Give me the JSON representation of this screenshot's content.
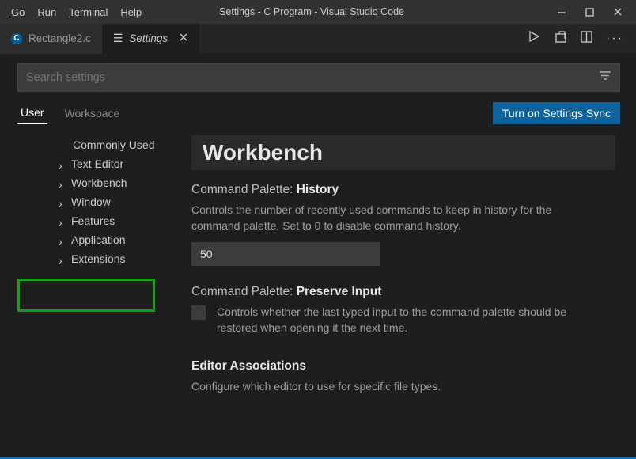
{
  "titlebar": {
    "menus": [
      "Go",
      "Run",
      "Terminal",
      "Help"
    ],
    "title": "Settings - C Program - Visual Studio Code"
  },
  "tabs": [
    {
      "label": "Rectangle2.c",
      "icon": "c-lang",
      "active": false
    },
    {
      "label": "Settings",
      "icon": "gear",
      "active": true
    }
  ],
  "search": {
    "placeholder": "Search settings"
  },
  "scope": {
    "user": "User",
    "workspace": "Workspace"
  },
  "syncButton": "Turn on Settings Sync",
  "sidebar": {
    "items": [
      {
        "label": "Commonly Used",
        "expandable": false
      },
      {
        "label": "Text Editor",
        "expandable": true
      },
      {
        "label": "Workbench",
        "expandable": true
      },
      {
        "label": "Window",
        "expandable": true
      },
      {
        "label": "Features",
        "expandable": true
      },
      {
        "label": "Application",
        "expandable": true
      },
      {
        "label": "Extensions",
        "expandable": true
      }
    ]
  },
  "main": {
    "heading": "Workbench",
    "settings": [
      {
        "groupLabel": "Command Palette: ",
        "name": "History",
        "desc": "Controls the number of recently used commands to keep in history for the command palette. Set to 0 to disable command history.",
        "value": "50",
        "type": "number"
      },
      {
        "groupLabel": "Command Palette: ",
        "name": "Preserve Input",
        "desc": "Controls whether the last typed input to the command palette should be restored when opening it the next time.",
        "type": "checkbox"
      },
      {
        "groupLabel": "",
        "name": "Editor Associations",
        "desc": "Configure which editor to use for specific file types.",
        "type": "info"
      }
    ]
  }
}
